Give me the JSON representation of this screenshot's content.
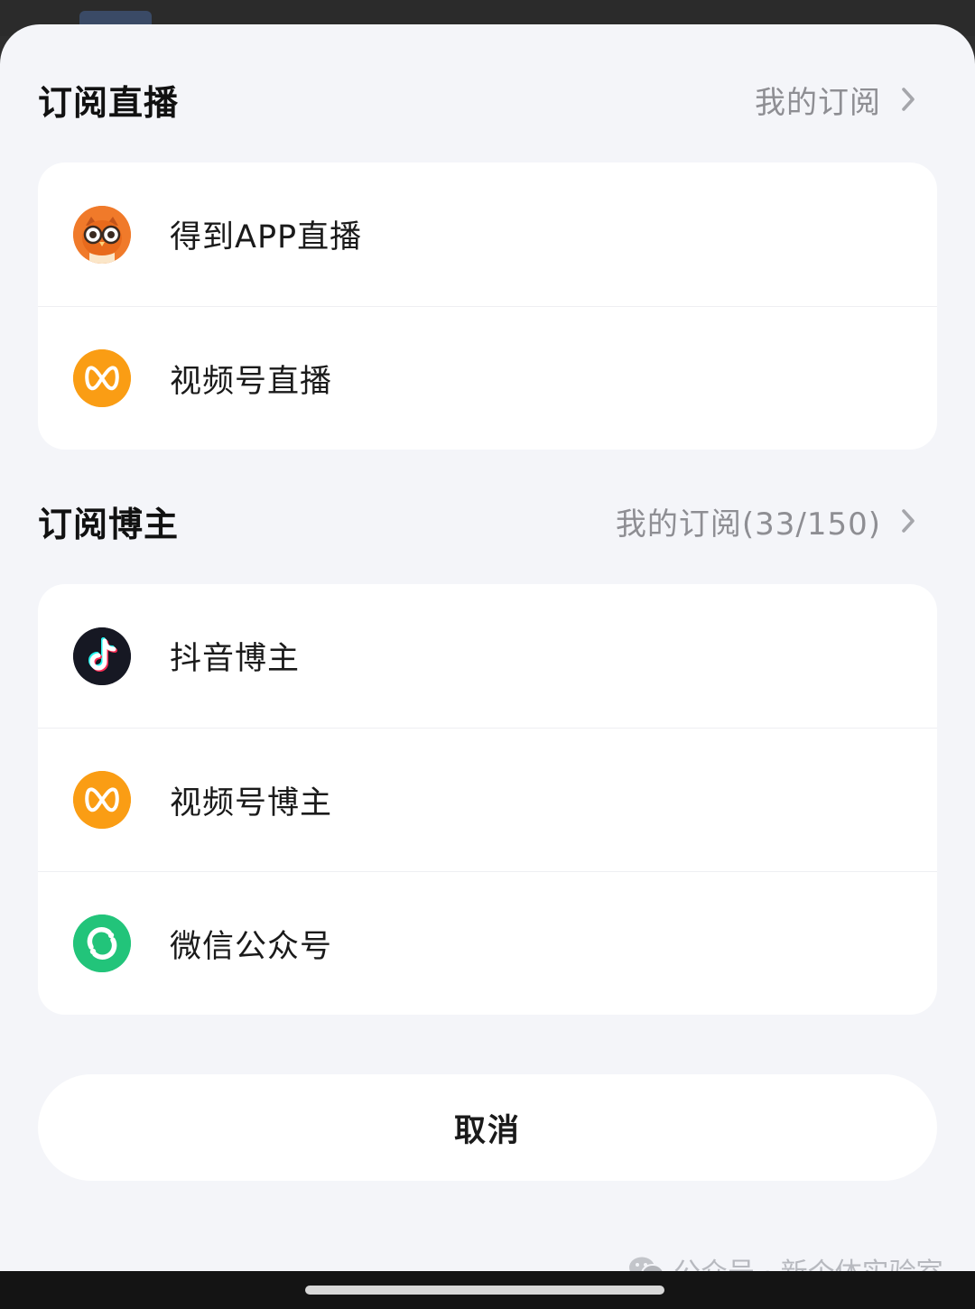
{
  "sections": {
    "live": {
      "title": "订阅直播",
      "link_label": "我的订阅",
      "items": [
        {
          "label": "得到APP直播",
          "icon": "dedao-owl-icon"
        },
        {
          "label": "视频号直播",
          "icon": "channels-icon"
        }
      ]
    },
    "creators": {
      "title": "订阅博主",
      "link_label": "我的订阅(33/150)",
      "items": [
        {
          "label": "抖音博主",
          "icon": "douyin-icon"
        },
        {
          "label": "视频号博主",
          "icon": "channels-icon"
        },
        {
          "label": "微信公众号",
          "icon": "official-account-icon"
        }
      ]
    }
  },
  "cancel_label": "取消",
  "watermark": "公众号 · 新个体实验室",
  "colors": {
    "sheet_background": "#f4f5f9",
    "card_background": "#ffffff",
    "secondary_text": "#8e8e93",
    "channels_orange": "#fa9d14",
    "dedao_orange": "#f07a2a",
    "official_account_green": "#22c47a",
    "douyin_black": "#161823"
  }
}
